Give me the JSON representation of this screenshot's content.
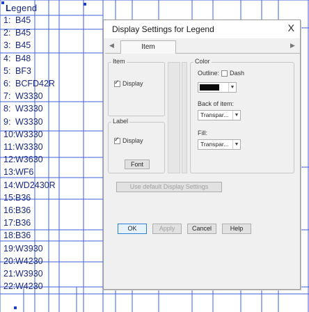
{
  "legend": {
    "title": "Legend",
    "items": [
      {
        "num": "1:",
        "label": "B45"
      },
      {
        "num": "2:",
        "label": "B45"
      },
      {
        "num": "3:",
        "label": "B45"
      },
      {
        "num": "4:",
        "label": "B48"
      },
      {
        "num": "5:",
        "label": "BF3"
      },
      {
        "num": "6:",
        "label": "BCFD42R"
      },
      {
        "num": "7:",
        "label": "W3330"
      },
      {
        "num": "8:",
        "label": "W3330"
      },
      {
        "num": "9:",
        "label": "W3330"
      },
      {
        "num": "10:",
        "label": "W3330"
      },
      {
        "num": "11:",
        "label": "W3330"
      },
      {
        "num": "12:",
        "label": "W3630"
      },
      {
        "num": "13:",
        "label": "WF6"
      },
      {
        "num": "14:",
        "label": "WD2430R"
      },
      {
        "num": "15:",
        "label": "B36"
      },
      {
        "num": "16:",
        "label": "B36"
      },
      {
        "num": "17:",
        "label": "B36"
      },
      {
        "num": "18:",
        "label": "B36"
      },
      {
        "num": "19:",
        "label": "W3930"
      },
      {
        "num": "20:",
        "label": "W4230"
      },
      {
        "num": "21:",
        "label": "W3930"
      },
      {
        "num": "22:",
        "label": "W4230"
      }
    ]
  },
  "dialog": {
    "title": "Display Settings for Legend",
    "close_glyph": "X",
    "tab_prev_glyph": "◀",
    "tab_next_glyph": "▶",
    "tab_label": "Item",
    "item_group": {
      "label": "Item",
      "display_label": "Display"
    },
    "label_group": {
      "label": "Label",
      "display_label": "Display",
      "font_button": "Font"
    },
    "color_group": {
      "label": "Color",
      "outline_label": "Outline:",
      "dash_label": "Dash",
      "back_label": "Back of item:",
      "back_value": "Transpar...",
      "fill_label": "Fill:",
      "fill_value": "Transpar...",
      "outline_color": "#0a0a0a"
    },
    "use_default": "Use default Display Settings",
    "buttons": {
      "ok": "OK",
      "apply": "Apply",
      "cancel": "Cancel",
      "help": "Help"
    }
  },
  "colors": {
    "grid": "#3f5fd8",
    "text": "#1a2a7a"
  }
}
